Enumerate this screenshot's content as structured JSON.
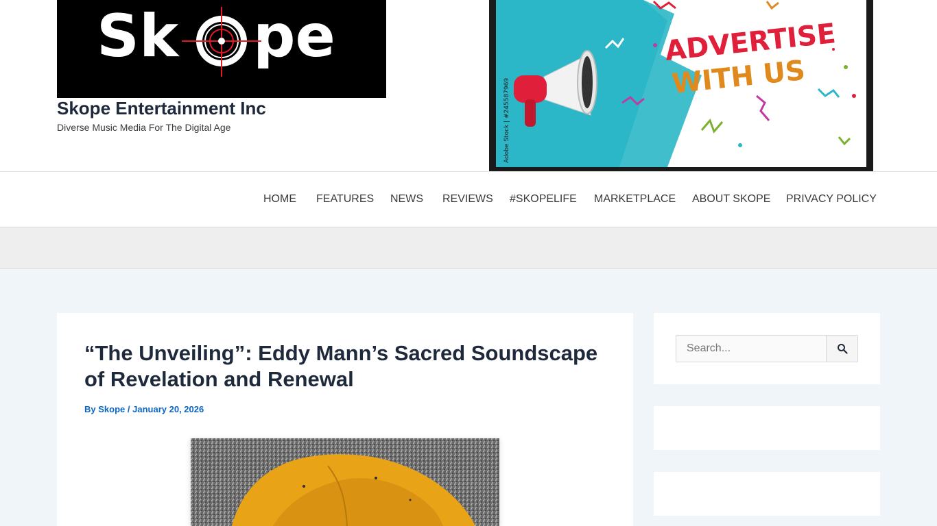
{
  "site": {
    "logo_text": "Skope",
    "title": "Skope Entertainment Inc",
    "tagline": "Diverse Music Media For The Digital Age"
  },
  "ad": {
    "headline_line1": "ADVERTISE",
    "headline_line2": "WITH US",
    "watermark": "Adobe Stock",
    "credit": "Adobe Stock | #245587969"
  },
  "nav": {
    "items": [
      {
        "label": "HOME"
      },
      {
        "label": "FEATURES"
      },
      {
        "label": "NEWS"
      },
      {
        "label": "REVIEWS"
      },
      {
        "label": "#SKOPELIFE"
      },
      {
        "label": "MARKETPLACE"
      },
      {
        "label": "ABOUT SKOPE"
      },
      {
        "label": "PRIVACY POLICY"
      }
    ]
  },
  "article": {
    "title": "“The Unveiling”: Eddy Mann’s Sacred Soundscape of Revelation and Renewal",
    "by_label": "By",
    "author": "Skope",
    "separator": "/",
    "date": "January 20, 2026"
  },
  "sidebar": {
    "search_placeholder": "Search...",
    "search_icon": "search-icon"
  },
  "colors": {
    "link": "#0b66c2",
    "heading": "#1e293b",
    "page_bg": "#f0f5fa",
    "ad_teal": "#2bb7c7",
    "logo_red": "#e01b24"
  }
}
